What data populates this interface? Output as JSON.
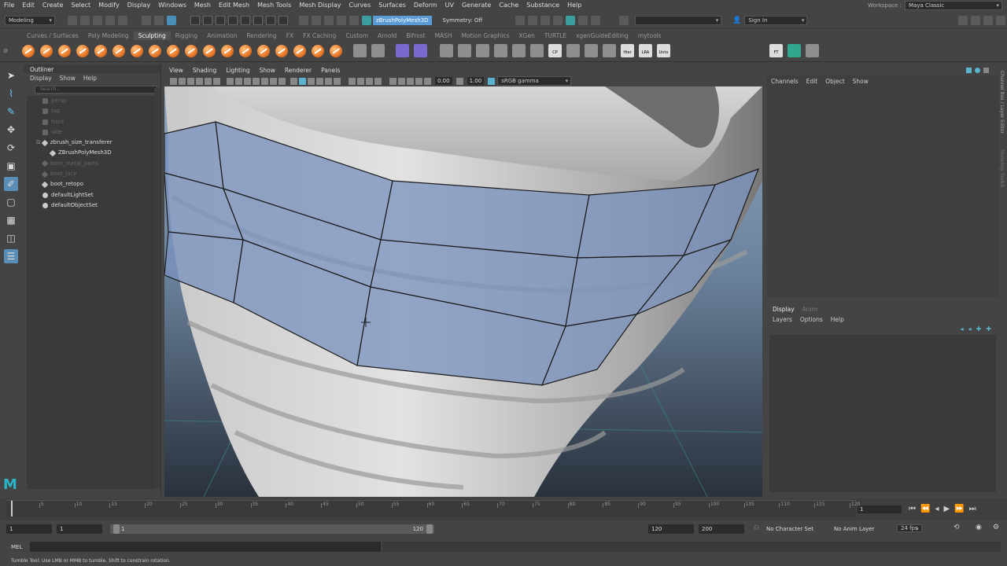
{
  "menubar": {
    "items": [
      "File",
      "Edit",
      "Create",
      "Select",
      "Modify",
      "Display",
      "Windows",
      "Mesh",
      "Edit Mesh",
      "Mesh Tools",
      "Mesh Display",
      "Curves",
      "Surfaces",
      "Deform",
      "UV",
      "Generate",
      "Cache",
      "Substance",
      "Help"
    ],
    "workspace_label": "Workspace :",
    "workspace_value": "Maya Classic"
  },
  "statusline": {
    "mode": "Modeling",
    "object_name": "zBrushPolyMesh3D",
    "symmetry": "Symmetry: Off",
    "sign_in": "Sign In"
  },
  "shelf": {
    "tabs": [
      "Curves / Surfaces",
      "Poly Modeling",
      "Sculpting",
      "Rigging",
      "Animation",
      "Rendering",
      "FX",
      "FX Caching",
      "Custom",
      "Arnold",
      "Bifrost",
      "MASH",
      "Motion Graphics",
      "XGen",
      "TURTLE",
      "xgenGuideEditing",
      "mytools"
    ],
    "active_tab": "Sculpting",
    "labels": [
      "CP",
      "Hier",
      "LRA",
      "Unto",
      "FT"
    ]
  },
  "outliner": {
    "title": "Outliner",
    "menu": [
      "Display",
      "Show",
      "Help"
    ],
    "search_placeholder": "Search...",
    "items": [
      {
        "label": "persp",
        "dim": true,
        "kind": "cam",
        "indent": 0
      },
      {
        "label": "top",
        "dim": true,
        "kind": "cam",
        "indent": 0
      },
      {
        "label": "front",
        "dim": true,
        "kind": "cam",
        "indent": 0
      },
      {
        "label": "side",
        "dim": true,
        "kind": "cam",
        "indent": 0
      },
      {
        "label": "zbrush_size_transferer",
        "dim": false,
        "kind": "grp",
        "indent": 0
      },
      {
        "label": "ZBrushPolyMesh3D",
        "dim": false,
        "kind": "grp",
        "indent": 1
      },
      {
        "label": "boot_metal_parts",
        "dim": true,
        "kind": "grp",
        "indent": 0
      },
      {
        "label": "boot_lace",
        "dim": true,
        "kind": "grp",
        "indent": 0
      },
      {
        "label": "boot_retopo",
        "dim": false,
        "kind": "grp",
        "indent": 0
      },
      {
        "label": "defaultLightSet",
        "dim": false,
        "kind": "set",
        "indent": 0
      },
      {
        "label": "defaultObjectSet",
        "dim": false,
        "kind": "set",
        "indent": 0
      }
    ]
  },
  "viewport": {
    "menu": [
      "View",
      "Shading",
      "Lighting",
      "Show",
      "Renderer",
      "Panels"
    ],
    "exposure": "0.00",
    "gamma": "1.00",
    "colorspace": "sRGB gamma"
  },
  "channelbox": {
    "menu": [
      "Channels",
      "Edit",
      "Object",
      "Show"
    ],
    "side_tabs": [
      "Channel Box / Layer Editor",
      "Modeling Toolkit"
    ]
  },
  "layereditor": {
    "tabs": [
      "Display",
      "Anim"
    ],
    "menu": [
      "Layers",
      "Options",
      "Help"
    ]
  },
  "timeline": {
    "ticks": [
      "1",
      "5",
      "10",
      "15",
      "20",
      "25",
      "30",
      "35",
      "40",
      "45",
      "50",
      "55",
      "60",
      "65",
      "70",
      "75",
      "80",
      "85",
      "90",
      "95",
      "100",
      "105",
      "110",
      "115",
      "120"
    ],
    "current_frame": "1"
  },
  "range": {
    "start": "1",
    "playback_start": "1",
    "slider_start": "1",
    "slider_end": "120",
    "playback_end": "120",
    "end": "200",
    "character_set": "No Character Set",
    "anim_layer": "No Anim Layer",
    "fps": "24 fps"
  },
  "cmdline": {
    "mel": "MEL",
    "help": "Tumble Tool: Use LMB or MMB to tumble. Shift to constrain rotation."
  }
}
